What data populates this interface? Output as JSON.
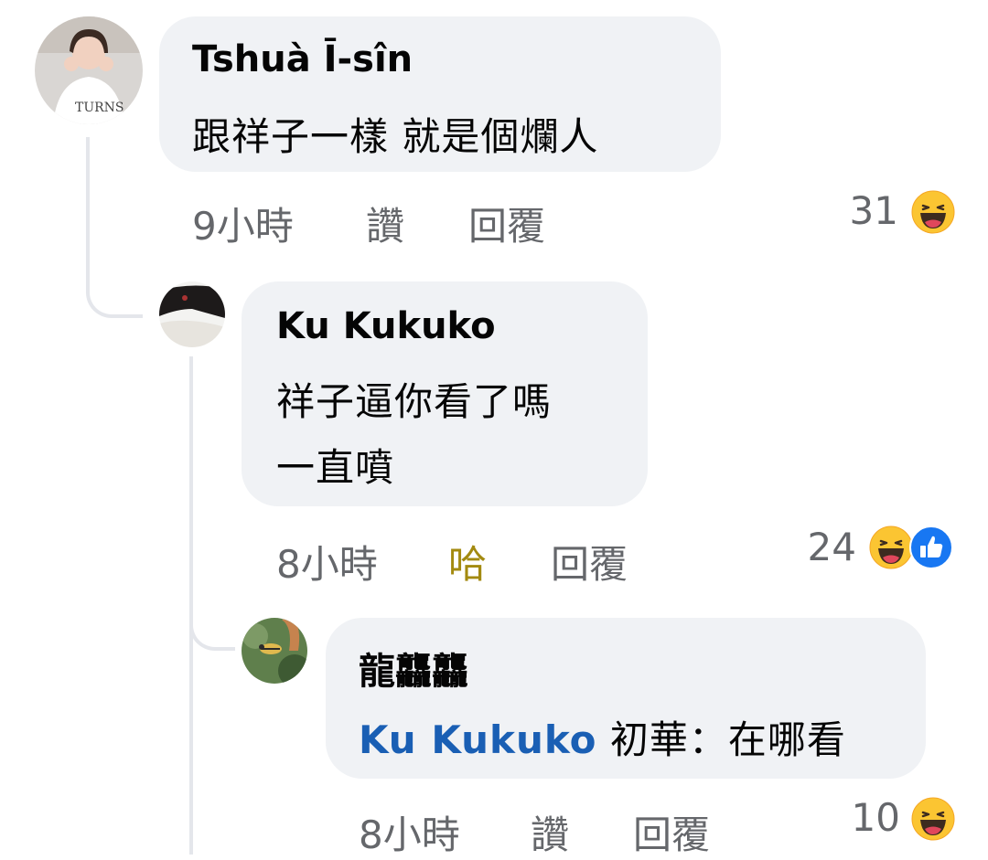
{
  "comments": [
    {
      "author": "Tshuà Ī-sîn",
      "text_lines": [
        "跟祥子一樣 就是個爛人"
      ],
      "time": "9小時",
      "like": "讚",
      "reply": "回覆",
      "reaction_count": "31",
      "reactions": [
        "haha-icon"
      ]
    },
    {
      "author": "Ku Kukuko",
      "text_lines": [
        "祥子逼你看了嗎",
        "一直噴"
      ],
      "time": "8小時",
      "like": "哈",
      "reply": "回覆",
      "reaction_count": "24",
      "reactions": [
        "haha-icon",
        "like-icon"
      ]
    },
    {
      "author": "龍龘龘",
      "mention": "Ku Kukuko",
      "text": "初華：在哪看",
      "time": "8小時",
      "like": "讚",
      "reply": "回覆",
      "reaction_count": "10",
      "reactions": [
        "haha-icon"
      ]
    }
  ],
  "colors": {
    "bubble": "#f0f2f5",
    "meta": "#65676b",
    "mention": "#1a5fb4",
    "haha_active": "#a38a10",
    "like_blue": "#1877f2"
  }
}
